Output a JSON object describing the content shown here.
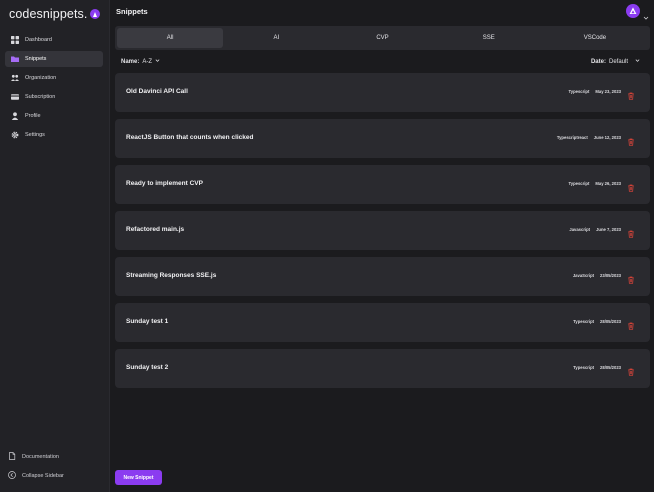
{
  "brand": {
    "name": "codesnippets."
  },
  "sidebar": {
    "items": [
      {
        "label": "Dashboard",
        "icon": "grid-icon"
      },
      {
        "label": "Snippets",
        "icon": "folder-icon"
      },
      {
        "label": "Organization",
        "icon": "users-icon"
      },
      {
        "label": "Subscription",
        "icon": "card-icon"
      },
      {
        "label": "Profile",
        "icon": "user-icon"
      },
      {
        "label": "Settings",
        "icon": "gear-icon"
      }
    ],
    "active": "Snippets",
    "bottom": [
      {
        "label": "Documentation",
        "icon": "document-icon"
      },
      {
        "label": "Collapse Sidebar",
        "icon": "arrow-left-circle-icon"
      }
    ]
  },
  "header": {
    "title": "Snippets"
  },
  "tabs": [
    {
      "label": "All"
    },
    {
      "label": "AI"
    },
    {
      "label": "CVP"
    },
    {
      "label": "SSE"
    },
    {
      "label": "VSCode"
    }
  ],
  "filters": {
    "name_label": "Name:",
    "name_value": "A-Z",
    "date_label": "Date:",
    "date_value": "Default"
  },
  "snippets": [
    {
      "title": "Old Davinci API Call",
      "language": "Typescript",
      "date": "May 23, 2023"
    },
    {
      "title": "ReactJS Button that counts when clicked",
      "language": "Typescriptreact",
      "date": "June 12, 2023"
    },
    {
      "title": "Ready to implement CVP",
      "language": "Typescript",
      "date": "May 26, 2023"
    },
    {
      "title": "Refactored main.js",
      "language": "Javascript",
      "date": "June 7, 2023"
    },
    {
      "title": "Streaming Responses SSE.js",
      "language": "JavaScript",
      "date": "23/05/2023"
    },
    {
      "title": "Sunday test 1",
      "language": "Typescript",
      "date": "28/05/2023"
    },
    {
      "title": "Sunday test 2",
      "language": "Typescript",
      "date": "28/05/2023"
    }
  ],
  "actions": {
    "new_snippet": "New Snippet"
  },
  "colors": {
    "accent": "#8b3cf0",
    "delete": "#e0453a",
    "background": "#1b1b1e",
    "card": "#2a2a2f"
  }
}
